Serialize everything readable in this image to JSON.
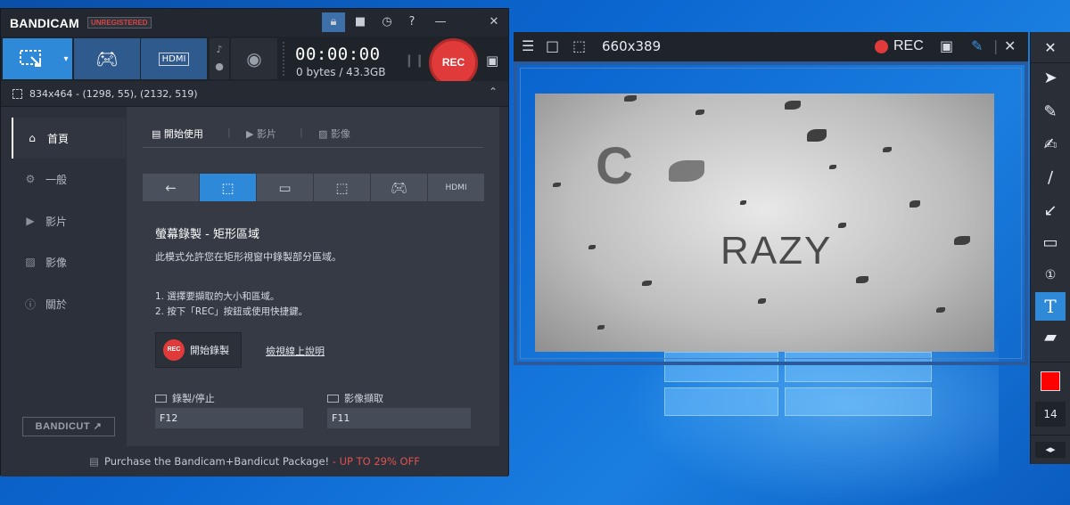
{
  "app": {
    "name": "BANDICAM",
    "badge": "UNREGISTERED",
    "title_buttons": [
      "lock-icon",
      "folder-icon",
      "clock-icon",
      "help-icon",
      "minimize-icon",
      "close-icon"
    ]
  },
  "toolbar": {
    "modes": [
      "screen-rect-icon",
      "game-icon",
      "hdmi-icon"
    ],
    "timer": "00:00:00",
    "bytes": "0 bytes / 43.3GB",
    "rec_label": "REC"
  },
  "info_bar": {
    "text": "834x464 - (1298, 55), (2132, 519)"
  },
  "sidebar": {
    "items": [
      {
        "label": "首頁",
        "icon": "home-icon"
      },
      {
        "label": "一般",
        "icon": "gear-icon"
      },
      {
        "label": "影片",
        "icon": "video-icon"
      },
      {
        "label": "影像",
        "icon": "image-icon"
      },
      {
        "label": "關於",
        "icon": "info-icon"
      }
    ],
    "bandicut_label": "BANDICUT"
  },
  "main": {
    "tabs": [
      "開始使用",
      "影片",
      "影像"
    ],
    "mode_title": "螢幕錄製 - 矩形區域",
    "mode_desc": "此模式允許您在矩形視窗中錄製部分區域。",
    "steps": [
      "1. 選擇要擷取的大小和區域。",
      "2. 按下「REC」按鈕或使用快捷鍵。"
    ],
    "start_rec_small": "REC",
    "start_button": "開始錄製",
    "help_link": "檢視線上說明",
    "hotkeys": [
      {
        "label": "錄製/停止",
        "value": "F12"
      },
      {
        "label": "影像擷取",
        "value": "F11"
      }
    ]
  },
  "promo": {
    "text": "Purchase the Bandicam+Bandicut Package!",
    "highlight": " - UP TO 29% OFF"
  },
  "frame": {
    "size_text": "660x389",
    "rec_label": "REC",
    "video_text_c": "C",
    "video_text": "RAZY"
  },
  "draw_toolbar": {
    "tools": [
      "cursor-icon",
      "pencil-icon",
      "highlighter-icon",
      "line-icon",
      "arrow-icon",
      "rectangle-icon",
      "number-icon",
      "text-icon",
      "eraser-icon"
    ],
    "selected": "text-icon",
    "color": "#ff0000",
    "size": "14"
  }
}
